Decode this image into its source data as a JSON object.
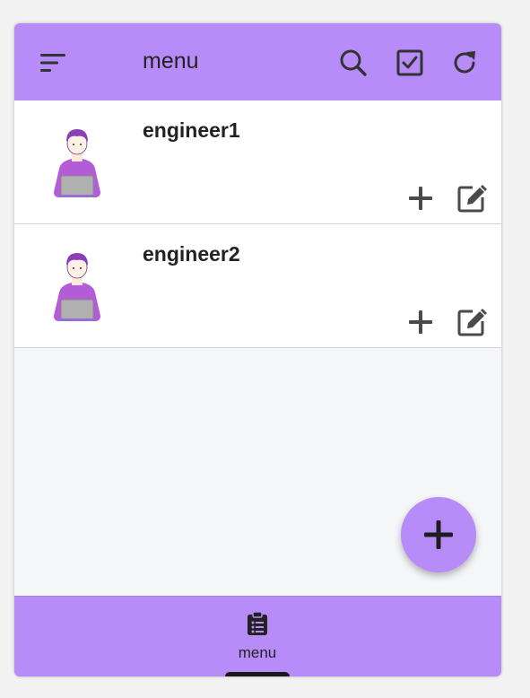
{
  "appbar": {
    "title": "menu",
    "icons": [
      "sort-icon",
      "search-icon",
      "checkbox-icon",
      "refresh-icon"
    ]
  },
  "list": {
    "items": [
      {
        "name": "engineer1",
        "avatar": "engineer-avatar-icon",
        "actions": [
          "plus-icon",
          "edit-icon"
        ]
      },
      {
        "name": "engineer2",
        "avatar": "engineer-avatar-icon",
        "actions": [
          "plus-icon",
          "edit-icon"
        ]
      }
    ]
  },
  "fab": {
    "icon": "plus-icon"
  },
  "bottom_nav": {
    "items": [
      {
        "label": "menu",
        "icon": "clipboard-list-icon",
        "active": true
      }
    ]
  },
  "colors": {
    "accent": "#b78cf9",
    "background": "#f5f6f7",
    "row_background": "#ffffff",
    "icon": "#4a4a4a",
    "avatar_shirt": "#b45bd8"
  }
}
